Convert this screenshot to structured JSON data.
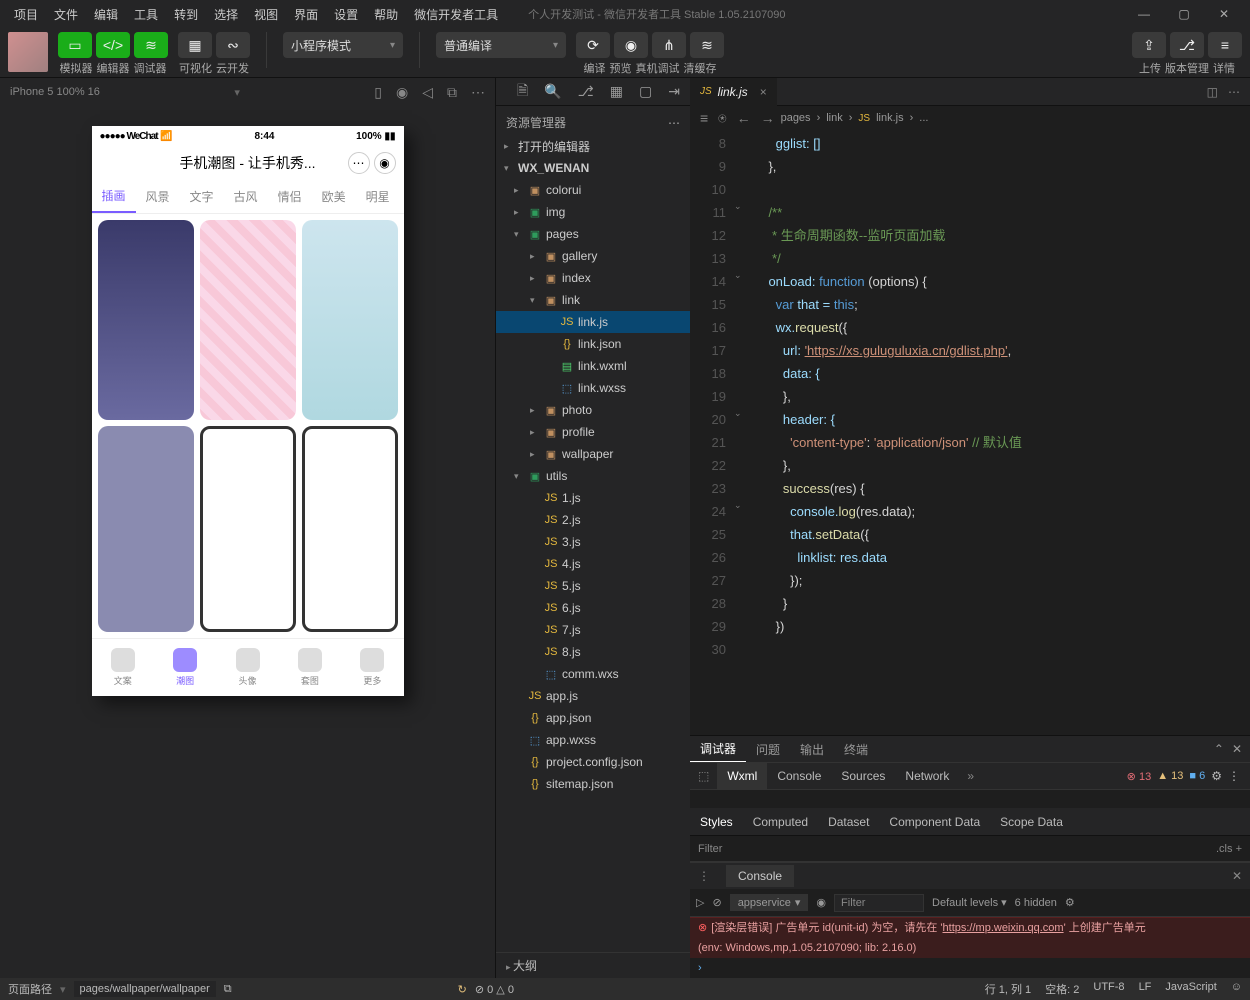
{
  "menu": [
    "项目",
    "文件",
    "编辑",
    "工具",
    "转到",
    "选择",
    "视图",
    "界面",
    "设置",
    "帮助",
    "微信开发者工具"
  ],
  "windowTitle": "个人开发测试 - 微信开发者工具 Stable 1.05.2107090",
  "toolbar": {
    "labels1": [
      "模拟器",
      "编辑器",
      "调试器"
    ],
    "labels2": [
      "可视化",
      "云开发"
    ],
    "mode": "小程序模式",
    "compile": "普通编译",
    "actions": [
      "编译",
      "预览",
      "真机调试",
      "清缓存"
    ],
    "right": [
      "上传",
      "版本管理",
      "详情"
    ]
  },
  "simbar": {
    "device": "iPhone 5 100% 16",
    "icons": [
      "▯",
      "◉",
      "◁",
      "⧉",
      "⋯"
    ]
  },
  "phone": {
    "carrier": "●●●●● WeChat",
    "wifi": "▸",
    "time": "8:44",
    "battery": "100%",
    "title": "手机潮图 - 让手机秀...",
    "tabs": [
      "插画",
      "风景",
      "文字",
      "古风",
      "情侣",
      "欧美",
      "明星"
    ],
    "bottom": [
      "文案",
      "潮图",
      "头像",
      "套图",
      "更多"
    ]
  },
  "explorerTitle": "资源管理器",
  "openEditors": "打开的编辑器",
  "project": "WX_WENAN",
  "tree": {
    "colorui": "colorui",
    "img": "img",
    "pages": "pages",
    "gallery": "gallery",
    "index": "index",
    "link": "link",
    "linkjs": "link.js",
    "linkjson": "link.json",
    "linkwxml": "link.wxml",
    "linkwxss": "link.wxss",
    "photo": "photo",
    "profile": "profile",
    "wallpaper": "wallpaper",
    "utils": "utils",
    "u1": "1.js",
    "u2": "2.js",
    "u3": "3.js",
    "u4": "4.js",
    "u5": "5.js",
    "u6": "6.js",
    "u7": "7.js",
    "u8": "8.js",
    "uc": "comm.wxs",
    "appjs": "app.js",
    "appjson": "app.json",
    "appwxss": "app.wxss",
    "proj": "project.config.json",
    "site": "sitemap.json"
  },
  "outline": "大纲",
  "tab": "link.js",
  "breadcrumb": [
    "pages",
    "link",
    "link.js",
    "..."
  ],
  "code": {
    "l8": "      gglist: []",
    "l9": "    },",
    "l11": "    /**",
    "l12": "     * 生命周期函数--监听页面加载",
    "l13": "     */",
    "l14a": "onLoad: ",
    "l14b": "function ",
    "l14c": "(options) {",
    "l15a": "var ",
    "l15b": "that = ",
    "l15c": "this",
    "l16a": "wx.",
    "l16b": "request",
    "l16c": "({",
    "l17a": "url: ",
    "l17b": "'https://xs.guluguluxia.cn/gdlist.php'",
    "l18": "data: {",
    "l19": "},",
    "l20": "header: {",
    "l21a": "'content-type'",
    "l21b": ": ",
    "l21c": "'application/json'",
    "l21d": " // 默认值",
    "l22": "},",
    "l23a": "success",
    "l23b": "(res) {",
    "l24a": "console.",
    "l24b": "log",
    "l24c": "(res.data);",
    "l25a": "that.",
    "l25b": "setData",
    "l25c": "({",
    "l26": "linklist: res.data",
    "l27": "});",
    "l28": "}",
    "l29": "})"
  },
  "debug": {
    "tabs": [
      "调试器",
      "问题",
      "输出",
      "终端"
    ],
    "tools": [
      "Wxml",
      "Console",
      "Sources",
      "Network"
    ],
    "badges": {
      "err": "13",
      "warn": "13",
      "info": "6"
    },
    "styles": [
      "Styles",
      "Computed",
      "Dataset",
      "Component Data",
      "Scope Data"
    ],
    "filter": "Filter",
    "cls": ".cls",
    "console": "Console",
    "context": "appservice",
    "levels": "Default levels",
    "hidden": "6 hidden",
    "errLine1": "[渲染层错误] 广告单元 id(unit-id) 为空，请先在 '",
    "errUrl": "https://mp.weixin.qq.com",
    "errLine1b": "' 上创建广告单元",
    "errLine2": "(env: Windows,mp,1.05.2107090; lib: 2.16.0)"
  },
  "status": {
    "pathLabel": "页面路径",
    "path": "pages/wallpaper/wallpaper",
    "issues": "⊘ 0 △ 0",
    "right": [
      "行 1, 列 1",
      "空格: 2",
      "UTF-8",
      "LF",
      "JavaScript"
    ]
  }
}
